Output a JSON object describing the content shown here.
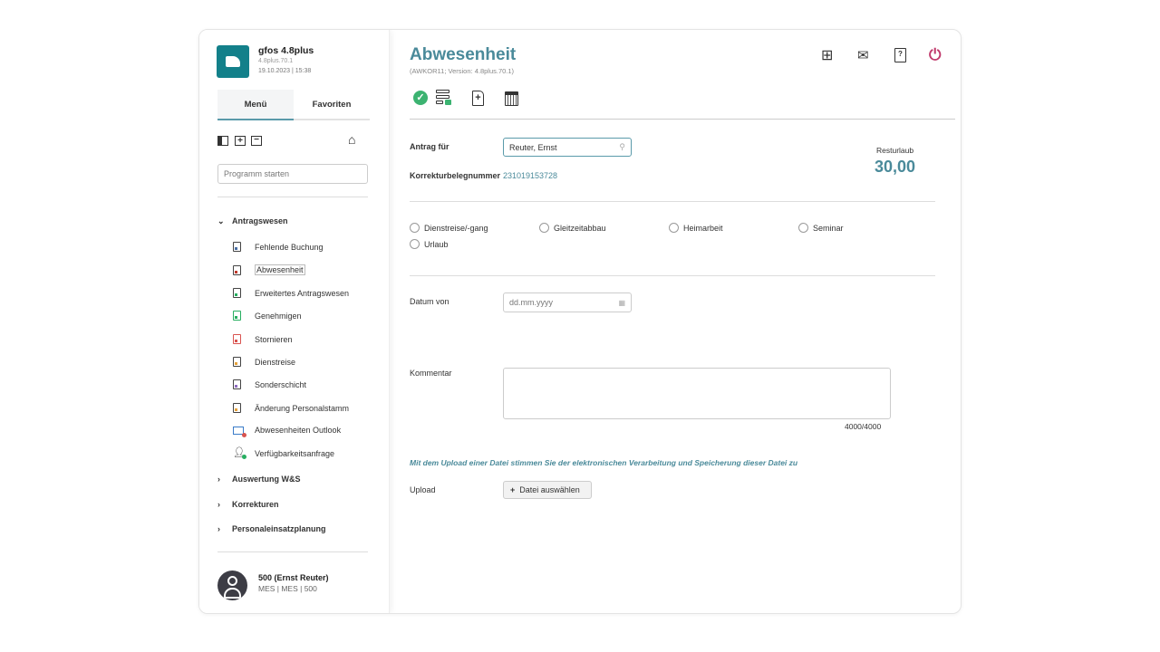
{
  "app": {
    "name": "gfos 4.8plus",
    "version": "4.8plus.70.1",
    "datetime": "19.10.2023 | 15:38"
  },
  "sidebar": {
    "tabs": [
      {
        "label": "Menü",
        "active": true
      },
      {
        "label": "Favoriten",
        "active": false
      }
    ],
    "search_placeholder": "Programm starten",
    "groups": [
      {
        "label": "Antragswesen",
        "expanded": true,
        "items": [
          {
            "label": "Fehlende Buchung",
            "icon": "document-icon",
            "color": "#4a6fa5"
          },
          {
            "label": "Abwesenheit",
            "icon": "document-icon",
            "color": "#c0392b",
            "selected": true
          },
          {
            "label": "Erweitertes Antragswesen",
            "icon": "document-icon",
            "color": "#27ae60"
          },
          {
            "label": "Genehmigen",
            "icon": "document-check-icon",
            "color": "#27ae60"
          },
          {
            "label": "Stornieren",
            "icon": "document-cancel-icon",
            "color": "#d9534f"
          },
          {
            "label": "Dienstreise",
            "icon": "document-icon",
            "color": "#e6a23c"
          },
          {
            "label": "Sonderschicht",
            "icon": "document-icon",
            "color": "#8e6bbf"
          },
          {
            "label": "Änderung Personalstamm",
            "icon": "document-icon",
            "color": "#e6a23c"
          },
          {
            "label": "Abwesenheiten Outlook",
            "icon": "mail-icon",
            "color": "#d9534f"
          },
          {
            "label": "Verfügbarkeitsanfrage",
            "icon": "user-icon",
            "color": "#27ae60"
          }
        ]
      },
      {
        "label": "Auswertung W&S",
        "expanded": false
      },
      {
        "label": "Korrekturen",
        "expanded": false
      },
      {
        "label": "Personaleinsatzplanung",
        "expanded": false
      }
    ],
    "user": {
      "name": "500 (Ernst Reuter)",
      "detail": "MES | MES | 500"
    }
  },
  "main": {
    "title": "Abwesenheit",
    "subtitle": "(AWKOR11; Version: 4.8plus.70.1)",
    "antrag_label": "Antrag für",
    "antrag_value": "Reuter, Ernst",
    "beleg_label": "Korrekturbelegnummer",
    "beleg_value": "231019153728",
    "rest_label": "Resturlaub",
    "rest_value": "30,00",
    "radios": [
      "Dienstreise/-gang",
      "Gleitzeitabbau",
      "Heimarbeit",
      "Seminar",
      "Urlaub"
    ],
    "datum_label": "Datum von",
    "datum_placeholder": "dd.mm.yyyy",
    "kommentar_label": "Kommentar",
    "kommentar_counter": "4000/4000",
    "upload_notice": "Mit dem Upload einer Datei stimmen Sie der elektronischen Verarbeitung und Speicherung dieser Datei zu",
    "upload_label": "Upload",
    "upload_button": "Datei auswählen"
  },
  "colors": {
    "accent": "#4a8a9a",
    "logo": "#13808a",
    "power": "#c0396b",
    "check": "#3cb371"
  }
}
